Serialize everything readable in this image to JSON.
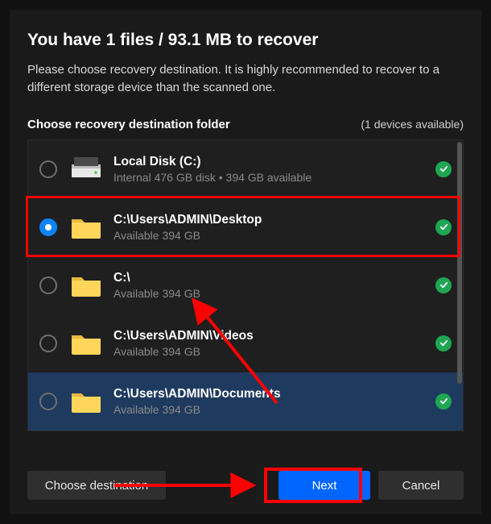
{
  "title": "You have 1 files / 93.1 MB to recover",
  "subtitle": "Please choose recovery destination. It is highly recommended to recover to a different storage device than the scanned one.",
  "section": {
    "label": "Choose recovery destination folder",
    "devices": "(1 devices available)"
  },
  "rows": [
    {
      "icon": "disk",
      "title": "Local Disk (C:)",
      "sub": "Internal 476 GB disk • 394 GB available",
      "selected": false
    },
    {
      "icon": "folder",
      "title": "C:\\Users\\ADMIN\\Desktop",
      "sub": "Available 394 GB",
      "selected": true
    },
    {
      "icon": "folder",
      "title": "C:\\",
      "sub": "Available 394 GB",
      "selected": false
    },
    {
      "icon": "folder",
      "title": "C:\\Users\\ADMIN\\Videos",
      "sub": "Available 394 GB",
      "selected": false
    },
    {
      "icon": "folder",
      "title": "C:\\Users\\ADMIN\\Documents",
      "sub": "Available 394 GB",
      "selected": false
    }
  ],
  "buttons": {
    "choose": "Choose destination",
    "next": "Next",
    "cancel": "Cancel"
  }
}
